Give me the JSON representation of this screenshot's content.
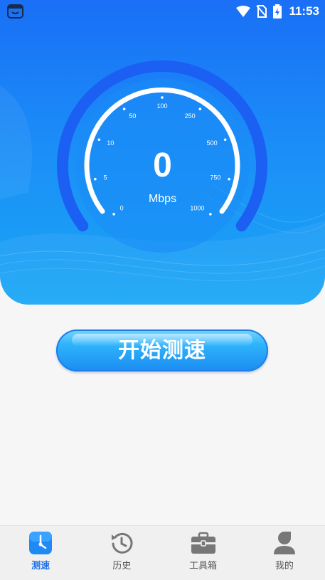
{
  "status_bar": {
    "time": "11:53",
    "icons": [
      "app-notification-icon",
      "wifi-icon",
      "no-sim-icon",
      "battery-charging-icon"
    ]
  },
  "gauge": {
    "value": "0",
    "unit": "Mbps",
    "ticks": [
      "0",
      "5",
      "10",
      "50",
      "100",
      "250",
      "500",
      "750",
      "1000"
    ]
  },
  "start_button": {
    "label": "开始测速"
  },
  "tabbar": {
    "items": [
      {
        "label": "测速",
        "icon": "speedometer-icon",
        "active": true
      },
      {
        "label": "历史",
        "icon": "history-icon",
        "active": false
      },
      {
        "label": "工具箱",
        "icon": "toolbox-icon",
        "active": false
      },
      {
        "label": "我的",
        "icon": "profile-icon",
        "active": false
      }
    ]
  },
  "colors": {
    "primary": "#1b7ff7",
    "tab_active": "#1e6fe8",
    "background": "#f6f6f6"
  }
}
